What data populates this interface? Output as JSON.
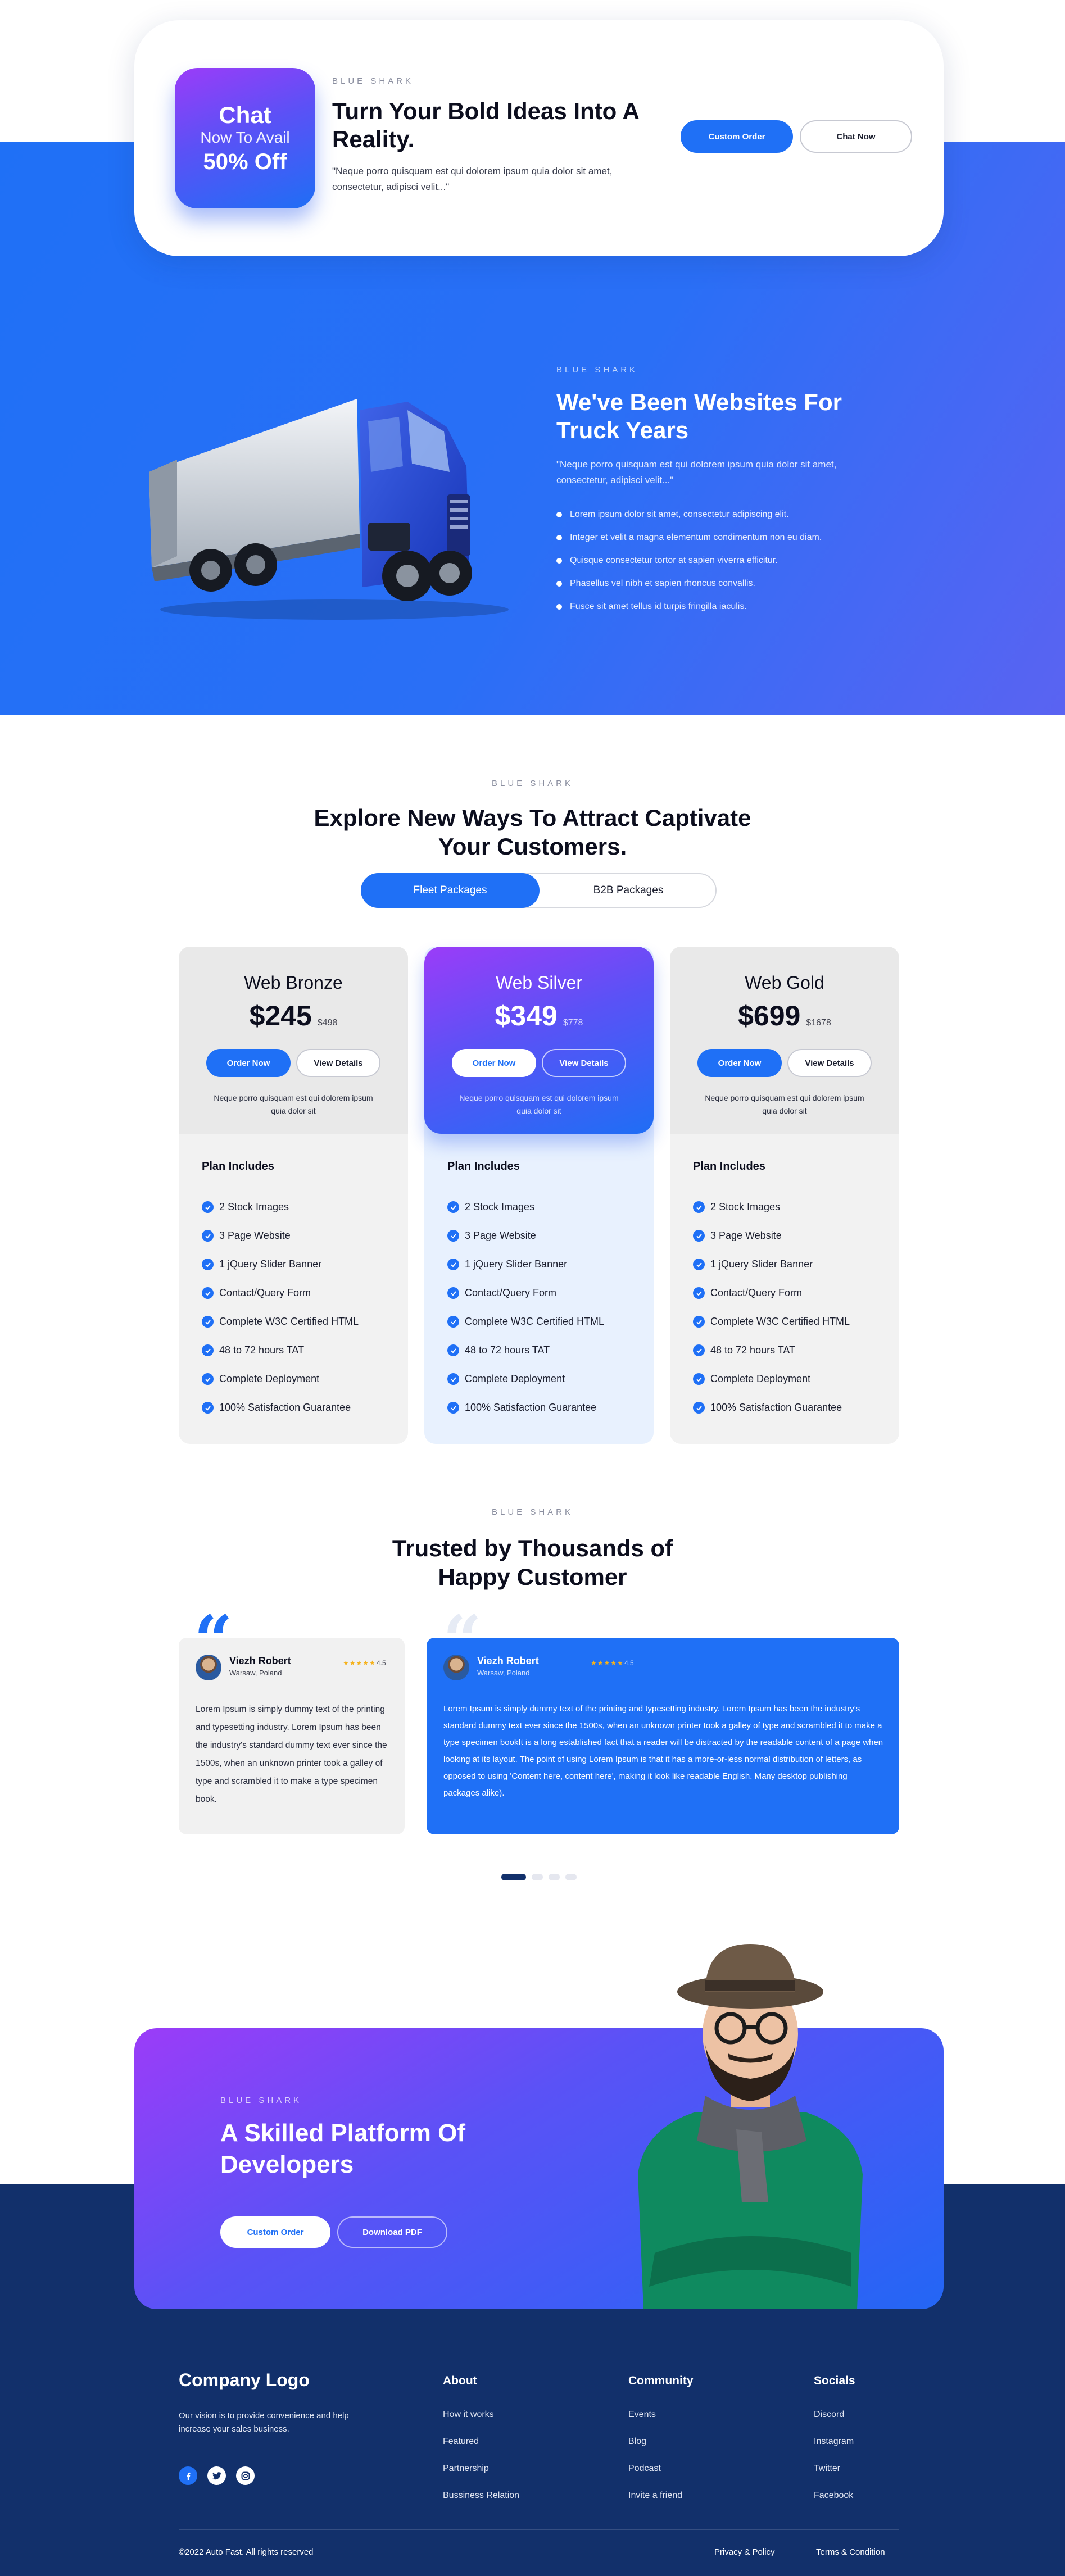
{
  "colors": {
    "accent": "#1f70f6",
    "navy": "#12306b",
    "purple": "#9b3cf8",
    "star": "#f5b21c"
  },
  "chat": {
    "badge_line1": "Chat",
    "badge_line2": "Now To Avail",
    "badge_line3": "50% Off",
    "eyebrow": "BLUE SHARK",
    "title": "Turn Your Bold Ideas Into A Reality.",
    "text": "\"Neque porro quisquam est qui dolorem ipsum quia dolor sit amet, consectetur, adipisci velit...\"",
    "primary": "Custom Order",
    "secondary": "Chat Now"
  },
  "trucks": {
    "eyebrow": "BLUE SHARK",
    "title": "We've Been Websites For Truck Years",
    "text": "\"Neque porro quisquam est qui dolorem ipsum quia dolor sit amet, consectetur, adipisci velit...\"",
    "bullets": [
      "Lorem ipsum dolor sit amet, consectetur adipiscing elit.",
      "Integer et velit a magna elementum condimentum non eu diam.",
      "Quisque consectetur tortor at sapien viverra efficitur.",
      "Phasellus vel nibh et sapien rhoncus convallis.",
      "Fusce sit amet tellus id turpis fringilla iaculis."
    ]
  },
  "pricing": {
    "eyebrow": "BLUE SHARK",
    "title": "Explore New Ways To Attract Captivate Your Customers.",
    "tabs": [
      "Fleet Packages",
      "B2B Packages"
    ],
    "plans": [
      {
        "name": "Web Bronze",
        "price": "$245",
        "old": "$498",
        "order": "Order Now",
        "details": "View Details",
        "blurb": "Neque porro quisquam est qui dolorem ipsum quia dolor sit",
        "includes_title": "Plan Includes",
        "features": [
          "2 Stock Images",
          "3 Page Website",
          "1 jQuery Slider Banner",
          "Contact/Query Form",
          "Complete W3C Certified HTML",
          "48 to 72 hours TAT",
          "Complete Deployment",
          "100% Satisfaction Guarantee"
        ]
      },
      {
        "name": "Web Silver",
        "price": "$349",
        "old": "$778",
        "order": "Order Now",
        "details": "View Details",
        "blurb": "Neque porro quisquam est qui dolorem ipsum quia dolor sit",
        "includes_title": "Plan Includes",
        "features": [
          "2 Stock Images",
          "3 Page Website",
          "1 jQuery Slider Banner",
          "Contact/Query Form",
          "Complete W3C Certified HTML",
          "48 to 72 hours TAT",
          "Complete Deployment",
          "100% Satisfaction Guarantee"
        ]
      },
      {
        "name": "Web Gold",
        "price": "$699",
        "old": "$1678",
        "order": "Order Now",
        "details": "View Details",
        "blurb": "Neque porro quisquam est qui dolorem ipsum quia dolor sit",
        "includes_title": "Plan Includes",
        "features": [
          "2 Stock Images",
          "3 Page Website",
          "1 jQuery Slider Banner",
          "Contact/Query Form",
          "Complete W3C Certified HTML",
          "48 to 72 hours TAT",
          "Complete Deployment",
          "100% Satisfaction Guarantee"
        ]
      }
    ]
  },
  "testimonials": {
    "eyebrow": "BLUE SHARK",
    "title": "Trusted by Thousands of Happy Customer",
    "reviews": [
      {
        "name": "Viezh Robert",
        "location": "Warsaw, Poland",
        "stars": "★★★★★",
        "rating": "4.5",
        "text": "Lorem Ipsum is simply dummy text of the printing and typesetting industry. Lorem Ipsum has been the industry's standard dummy text ever since the 1500s, when an unknown printer took a galley of type and scrambled it to make a type specimen book."
      },
      {
        "name": "Viezh Robert",
        "location": "Warsaw, Poland",
        "stars": "★★★★★",
        "rating": "4.5",
        "text": "Lorem Ipsum is simply dummy text of the printing and typesetting industry. Lorem Ipsum has been the industry's standard dummy text ever since the 1500s, when an unknown printer took a galley of type and scrambled it to make a type specimen bookIt is a long established fact that a reader will be distracted by the readable content of a page when looking at its layout. The point of using Lorem Ipsum is that it has a more-or-less normal distribution of letters, as opposed to using 'Content here, content here', making it look like readable English. Many desktop publishing packages alike)."
      }
    ],
    "slides": 4,
    "active_slide": 1
  },
  "cta": {
    "eyebrow": "BLUE SHARK",
    "title": "A Skilled Platform Of Developers",
    "primary": "Custom Order",
    "secondary": "Download PDF"
  },
  "footer": {
    "logo": "Company Logo",
    "tagline": "Our vision is to provide convenience and help increase your sales business.",
    "socials": [
      "facebook-icon",
      "twitter-icon",
      "instagram-icon"
    ],
    "columns": [
      {
        "title": "About",
        "links": [
          "How it works",
          "Featured",
          "Partnership",
          "Bussiness Relation"
        ]
      },
      {
        "title": "Community",
        "links": [
          "Events",
          "Blog",
          "Podcast",
          "Invite a friend"
        ]
      },
      {
        "title": "Socials",
        "links": [
          "Discord",
          "Instagram",
          "Twitter",
          "Facebook"
        ]
      }
    ],
    "copyright": "©2022 Auto Fast. All rights reserved",
    "privacy": "Privacy & Policy",
    "terms": "Terms & Condition"
  }
}
